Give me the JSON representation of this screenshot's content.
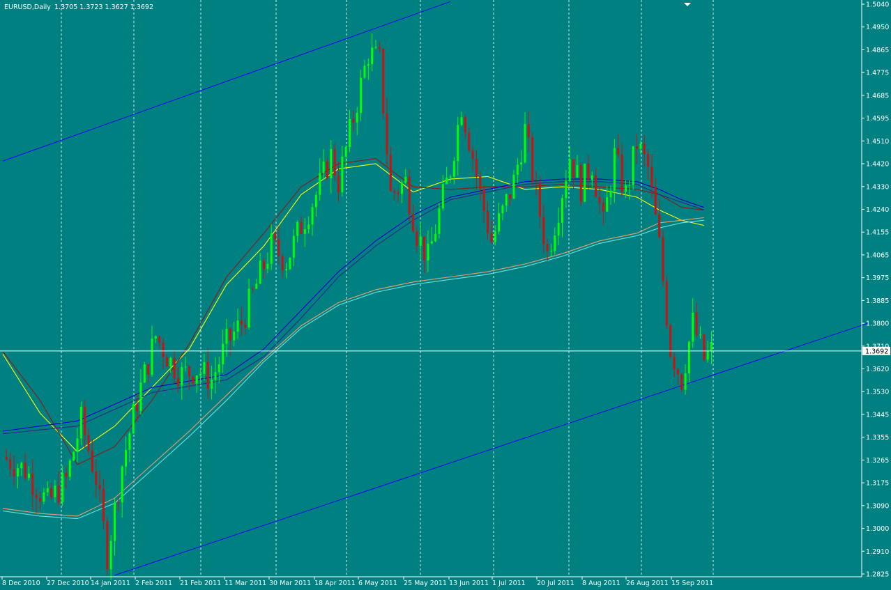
{
  "window": {
    "symbol": "EURUSD,Daily",
    "ohlc": "1.3705 1.3723 1.3627 1.3692"
  },
  "colors": {
    "background": "#008080",
    "axis": "#ffffff",
    "bull": "#00ff00",
    "bear": "#cc1111",
    "ma_yellow": "#ffff00",
    "ma_darkred": "#8b1a1a",
    "ma_blue": "#0000cc",
    "ma_navy": "#2a2a88",
    "ma_salmon": "#e8a070",
    "ma_cyan": "#70e0e0",
    "channel": "#0000ff"
  },
  "chart_data": {
    "type": "candlestick",
    "symbol": "EURUSD",
    "timeframe": "Daily",
    "last_price": "1.3692",
    "last_price_label": "1.3692",
    "ylim": [
      1.2825,
      1.504
    ],
    "y_ticks": [
      "1.5040",
      "1.4950",
      "1.4865",
      "1.4775",
      "1.4685",
      "1.4595",
      "1.4510",
      "1.4420",
      "1.4330",
      "1.4240",
      "1.4155",
      "1.4065",
      "1.3975",
      "1.3885",
      "1.3800",
      "1.3710",
      "1.3620",
      "1.3530",
      "1.3445",
      "1.3355",
      "1.3265",
      "1.3175",
      "1.3090",
      "1.3000",
      "1.2910",
      "1.2825"
    ],
    "x_ticks": [
      "8 Dec 2010",
      "27 Dec 2010",
      "14 Jan 2011",
      "2 Feb 2011",
      "21 Feb 2011",
      "11 Mar 2011",
      "30 Mar 2011",
      "18 Apr 2011",
      "6 May 2011",
      "25 May 2011",
      "13 Jun 2011",
      "1 Jul 2011",
      "20 Jul 2011",
      "8 Aug 2011",
      "26 Aug 2011",
      "15 Sep 2011"
    ],
    "price_path": [
      [
        0,
        1.328
      ],
      [
        6,
        1.323
      ],
      [
        12,
        1.31
      ],
      [
        17,
        1.319
      ],
      [
        21,
        1.342
      ],
      [
        25,
        1.32
      ],
      [
        28,
        1.29
      ],
      [
        32,
        1.325
      ],
      [
        36,
        1.35
      ],
      [
        41,
        1.375
      ],
      [
        45,
        1.365
      ],
      [
        48,
        1.36
      ],
      [
        52,
        1.362
      ],
      [
        56,
        1.358
      ],
      [
        60,
        1.372
      ],
      [
        64,
        1.38
      ],
      [
        68,
        1.395
      ],
      [
        72,
        1.41
      ],
      [
        76,
        1.404
      ],
      [
        80,
        1.418
      ],
      [
        84,
        1.43
      ],
      [
        88,
        1.445
      ],
      [
        90,
        1.435
      ],
      [
        94,
        1.46
      ],
      [
        98,
        1.485
      ],
      [
        101,
        1.482
      ],
      [
        104,
        1.43
      ],
      [
        108,
        1.435
      ],
      [
        111,
        1.415
      ],
      [
        114,
        1.405
      ],
      [
        117,
        1.423
      ],
      [
        120,
        1.44
      ],
      [
        123,
        1.465
      ],
      [
        126,
        1.445
      ],
      [
        128,
        1.43
      ],
      [
        131,
        1.412
      ],
      [
        134,
        1.423
      ],
      [
        137,
        1.435
      ],
      [
        140,
        1.455
      ],
      [
        143,
        1.43
      ],
      [
        146,
        1.407
      ],
      [
        149,
        1.425
      ],
      [
        152,
        1.445
      ],
      [
        155,
        1.433
      ],
      [
        158,
        1.442
      ],
      [
        161,
        1.418
      ],
      [
        164,
        1.445
      ],
      [
        167,
        1.43
      ],
      [
        170,
        1.45
      ],
      [
        173,
        1.44
      ],
      [
        176,
        1.41
      ],
      [
        179,
        1.37
      ],
      [
        182,
        1.358
      ],
      [
        185,
        1.38
      ],
      [
        188,
        1.366
      ],
      [
        190,
        1.3692
      ]
    ],
    "moving_averages": [
      {
        "color": "#ffff00",
        "values": [
          [
            0,
            1.368
          ],
          [
            10,
            1.345
          ],
          [
            20,
            1.33
          ],
          [
            30,
            1.34
          ],
          [
            40,
            1.355
          ],
          [
            50,
            1.37
          ],
          [
            60,
            1.395
          ],
          [
            70,
            1.41
          ],
          [
            80,
            1.43
          ],
          [
            90,
            1.44
          ],
          [
            100,
            1.442
          ],
          [
            110,
            1.431
          ],
          [
            120,
            1.436
          ],
          [
            130,
            1.437
          ],
          [
            140,
            1.432
          ],
          [
            150,
            1.433
          ],
          [
            160,
            1.432
          ],
          [
            170,
            1.429
          ],
          [
            176,
            1.424
          ],
          [
            182,
            1.42
          ],
          [
            188,
            1.418
          ]
        ]
      },
      {
        "color": "#8b1a1a",
        "values": [
          [
            0,
            1.369
          ],
          [
            10,
            1.35
          ],
          [
            20,
            1.325
          ],
          [
            30,
            1.332
          ],
          [
            40,
            1.35
          ],
          [
            50,
            1.372
          ],
          [
            60,
            1.398
          ],
          [
            70,
            1.415
          ],
          [
            80,
            1.433
          ],
          [
            90,
            1.442
          ],
          [
            100,
            1.444
          ],
          [
            110,
            1.433
          ],
          [
            120,
            1.432
          ],
          [
            130,
            1.433
          ],
          [
            140,
            1.433
          ],
          [
            150,
            1.434
          ],
          [
            160,
            1.433
          ],
          [
            170,
            1.432
          ],
          [
            176,
            1.43
          ],
          [
            182,
            1.425
          ],
          [
            188,
            1.424
          ]
        ]
      },
      {
        "color": "#0000cc",
        "values": [
          [
            0,
            1.338
          ],
          [
            20,
            1.342
          ],
          [
            40,
            1.355
          ],
          [
            60,
            1.36
          ],
          [
            70,
            1.37
          ],
          [
            80,
            1.385
          ],
          [
            90,
            1.4
          ],
          [
            100,
            1.412
          ],
          [
            110,
            1.422
          ],
          [
            120,
            1.429
          ],
          [
            130,
            1.432
          ],
          [
            140,
            1.435
          ],
          [
            150,
            1.436
          ],
          [
            160,
            1.436
          ],
          [
            170,
            1.435
          ],
          [
            176,
            1.432
          ],
          [
            182,
            1.428
          ],
          [
            188,
            1.425
          ]
        ]
      },
      {
        "color": "#2a2a88",
        "values": [
          [
            0,
            1.337
          ],
          [
            20,
            1.34
          ],
          [
            40,
            1.353
          ],
          [
            60,
            1.358
          ],
          [
            70,
            1.367
          ],
          [
            80,
            1.382
          ],
          [
            90,
            1.398
          ],
          [
            100,
            1.41
          ],
          [
            110,
            1.42
          ],
          [
            120,
            1.428
          ],
          [
            130,
            1.431
          ],
          [
            140,
            1.434
          ],
          [
            150,
            1.435
          ],
          [
            160,
            1.435
          ],
          [
            170,
            1.434
          ],
          [
            176,
            1.43
          ],
          [
            182,
            1.427
          ],
          [
            188,
            1.424
          ]
        ]
      },
      {
        "color": "#e8a070",
        "values": [
          [
            0,
            1.308
          ],
          [
            10,
            1.306
          ],
          [
            20,
            1.305
          ],
          [
            30,
            1.312
          ],
          [
            40,
            1.325
          ],
          [
            50,
            1.338
          ],
          [
            60,
            1.352
          ],
          [
            70,
            1.366
          ],
          [
            80,
            1.379
          ],
          [
            90,
            1.388
          ],
          [
            100,
            1.393
          ],
          [
            110,
            1.396
          ],
          [
            120,
            1.398
          ],
          [
            130,
            1.4
          ],
          [
            140,
            1.403
          ],
          [
            150,
            1.407
          ],
          [
            160,
            1.412
          ],
          [
            170,
            1.415
          ],
          [
            176,
            1.419
          ],
          [
            182,
            1.42
          ],
          [
            188,
            1.421
          ]
        ]
      },
      {
        "color": "#70e0e0",
        "values": [
          [
            0,
            1.307
          ],
          [
            10,
            1.305
          ],
          [
            20,
            1.304
          ],
          [
            30,
            1.31
          ],
          [
            40,
            1.323
          ],
          [
            50,
            1.336
          ],
          [
            60,
            1.35
          ],
          [
            70,
            1.365
          ],
          [
            80,
            1.378
          ],
          [
            90,
            1.387
          ],
          [
            100,
            1.392
          ],
          [
            110,
            1.395
          ],
          [
            120,
            1.397
          ],
          [
            130,
            1.399
          ],
          [
            140,
            1.402
          ],
          [
            150,
            1.406
          ],
          [
            160,
            1.411
          ],
          [
            170,
            1.414
          ],
          [
            176,
            1.417
          ],
          [
            182,
            1.419
          ],
          [
            188,
            1.42
          ]
        ]
      }
    ],
    "channel_lines": [
      {
        "from": [
          0,
          1.443
        ],
        "to": [
          120,
          1.505
        ]
      },
      {
        "from": [
          30,
          1.282
        ],
        "to": [
          232,
          1.38
        ]
      }
    ]
  }
}
